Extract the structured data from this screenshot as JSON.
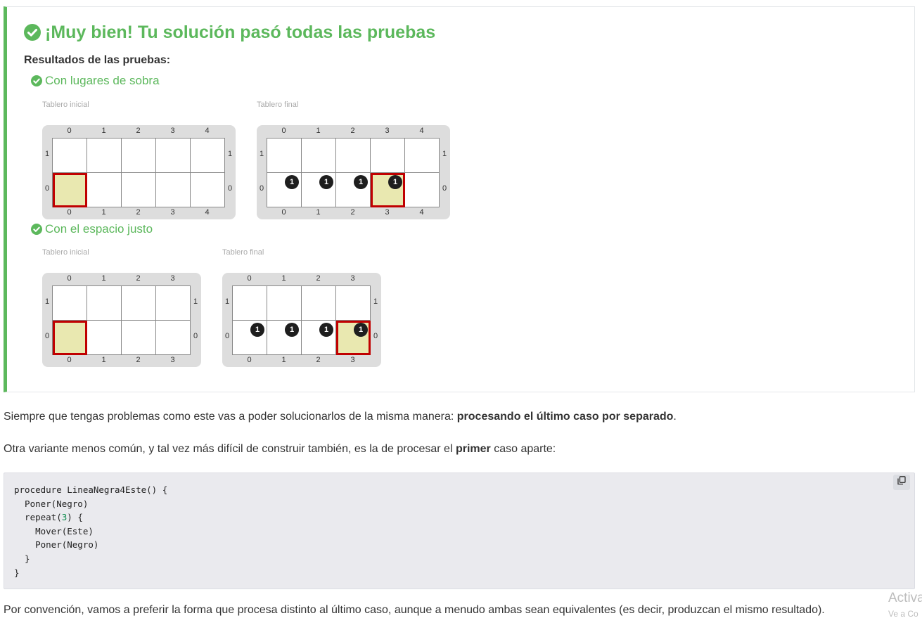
{
  "result": {
    "title": "¡Muy bien! Tu solución pasó todas las pruebas",
    "results_heading": "Resultados de las pruebas:",
    "tests": [
      {
        "title": "Con lugares de sobra",
        "initial_caption": "Tablero inicial",
        "final_caption": "Tablero final",
        "cols": [
          "0",
          "1",
          "2",
          "3",
          "4"
        ],
        "rows": [
          "1",
          "0"
        ],
        "initial": {
          "head": [
            0,
            0
          ],
          "balls": []
        },
        "final": {
          "head": [
            3,
            0
          ],
          "balls": [
            [
              0,
              0
            ],
            [
              1,
              0
            ],
            [
              2,
              0
            ],
            [
              3,
              0
            ]
          ]
        }
      },
      {
        "title": "Con el espacio justo",
        "initial_caption": "Tablero inicial",
        "final_caption": "Tablero final",
        "cols": [
          "0",
          "1",
          "2",
          "3"
        ],
        "rows": [
          "1",
          "0"
        ],
        "initial": {
          "head": [
            0,
            0
          ],
          "balls": []
        },
        "final": {
          "head": [
            3,
            0
          ],
          "balls": [
            [
              0,
              0
            ],
            [
              1,
              0
            ],
            [
              2,
              0
            ],
            [
              3,
              0
            ]
          ]
        }
      }
    ],
    "ball_count": "1"
  },
  "paragraphs": {
    "p1_text": "Siempre que tengas problemas como este vas a poder solucionarlos de la misma manera: ",
    "p1_bold": "procesando el último caso por separado",
    "p1_end": ".",
    "p2_text": "Otra variante menos común, y tal vez más difícil de construir también, es la de procesar el ",
    "p2_bold": "primer",
    "p2_end": " caso aparte:",
    "p3_text": "Por convención, vamos a preferir la forma que procesa distinto al último caso, aunque a menudo ambas sean equivalentes (es decir, produzcan el mismo resultado)."
  },
  "code": {
    "lines": [
      "procedure LineaNegra4Este() {",
      "  Poner(Negro)",
      "  repeat(3) {",
      "    Mover(Este)",
      "    Poner(Negro)",
      "  }",
      "}"
    ],
    "copy_icon": "copy-icon"
  },
  "watermark": {
    "line1": "Activa",
    "line2": "Ve a Co"
  },
  "colors": {
    "success": "#5cb85c",
    "head_border": "#c00000",
    "head_fill": "#e9e8b0",
    "board_bg": "#dddddd"
  }
}
